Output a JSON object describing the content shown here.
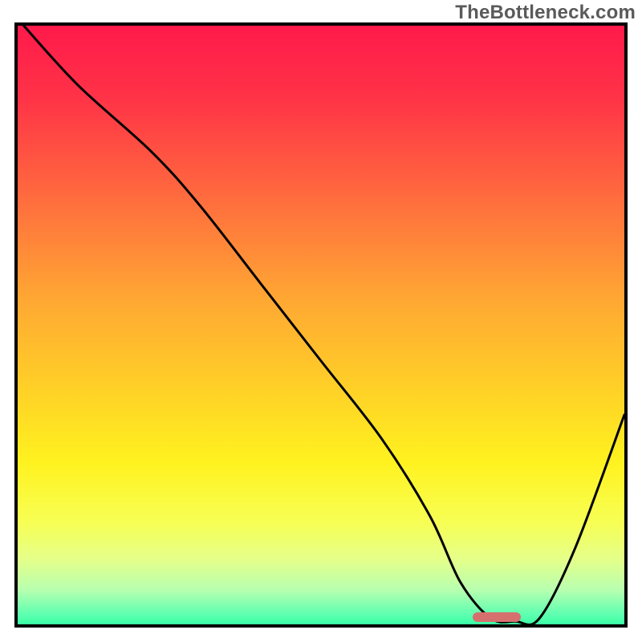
{
  "watermark": "TheBottleneck.com",
  "chart_data": {
    "type": "line",
    "title": "",
    "xlabel": "",
    "ylabel": "",
    "xlim": [
      0,
      100
    ],
    "ylim": [
      0,
      100
    ],
    "grid": false,
    "legend": false,
    "background_gradient": {
      "stops": [
        {
          "pct": 0,
          "color": "#ff1a4b"
        },
        {
          "pct": 12,
          "color": "#ff3347"
        },
        {
          "pct": 28,
          "color": "#ff6a3e"
        },
        {
          "pct": 45,
          "color": "#ffa733"
        },
        {
          "pct": 60,
          "color": "#ffd127"
        },
        {
          "pct": 72,
          "color": "#fff21f"
        },
        {
          "pct": 82,
          "color": "#f7ff55"
        },
        {
          "pct": 88,
          "color": "#e4ff8a"
        },
        {
          "pct": 93,
          "color": "#b8ffb0"
        },
        {
          "pct": 97,
          "color": "#5fffb0"
        },
        {
          "pct": 100,
          "color": "#1dff9e"
        }
      ]
    },
    "series": [
      {
        "name": "curve",
        "x": [
          1,
          10,
          22,
          30,
          40,
          50,
          60,
          68,
          73,
          78,
          82,
          86,
          92,
          100
        ],
        "y": [
          100,
          90,
          79,
          70,
          57,
          44,
          31,
          18,
          7,
          1,
          0.5,
          1,
          13,
          35
        ]
      }
    ],
    "marker": {
      "x_start": 75,
      "x_end": 83,
      "y": 1.2
    }
  }
}
